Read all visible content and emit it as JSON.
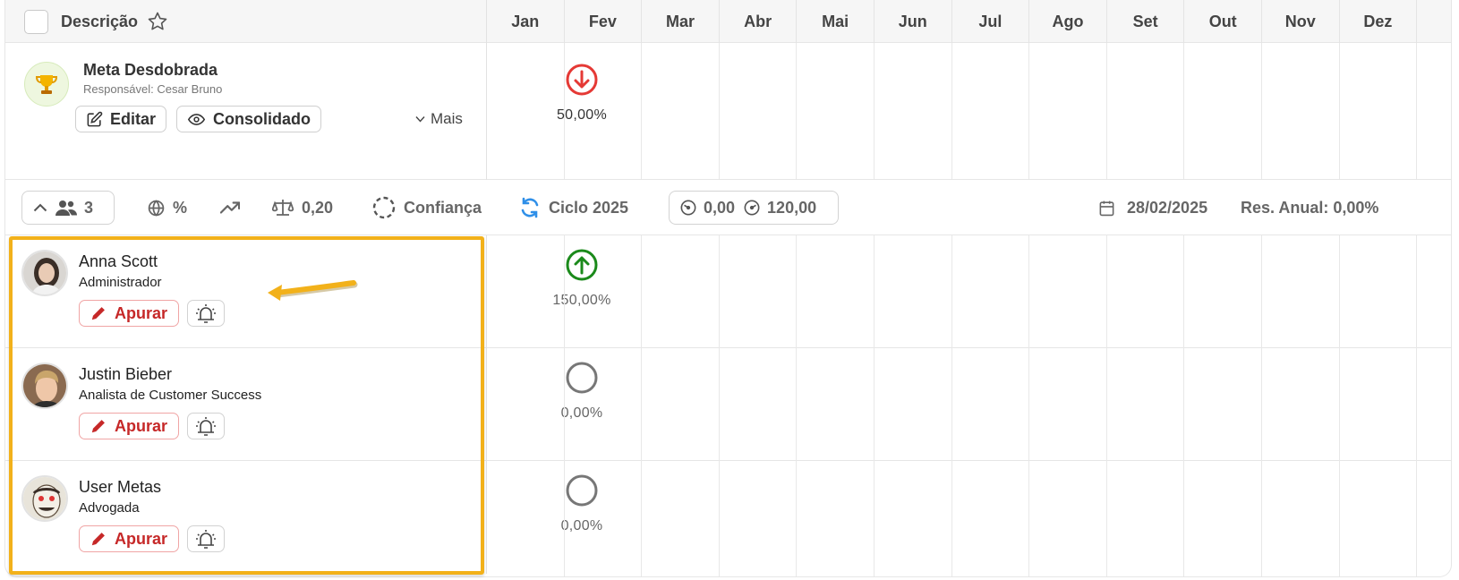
{
  "header": {
    "description_label": "Descrição",
    "months": [
      "Jan",
      "Fev",
      "Mar",
      "Abr",
      "Mai",
      "Jun",
      "Jul",
      "Ago",
      "Set",
      "Out",
      "Nov",
      "Dez"
    ]
  },
  "goal": {
    "title": "Meta Desdobrada",
    "responsible": "Responsável: Cesar Bruno",
    "edit_label": "Editar",
    "consolidated_label": "Consolidado",
    "more_label": "Mais",
    "feb_value": "50,00%",
    "feb_status": "down",
    "status_colors": {
      "down": "#e53935",
      "up": "#1b8a1b",
      "none": "#777777"
    }
  },
  "toolbar": {
    "participants_count": "3",
    "unit": "%",
    "weight": "0,20",
    "confidence_label": "Confiança",
    "cycle_label": "Ciclo 2025",
    "range_min": "0,00",
    "range_max": "120,00",
    "date": "28/02/2025",
    "annual_result": "Res. Anual: 0,00%"
  },
  "users": [
    {
      "name": "Anna Scott",
      "role": "Administrador",
      "apurar_label": "Apurar",
      "feb_value": "150,00%",
      "feb_status": "up"
    },
    {
      "name": "Justin Bieber",
      "role": "Analista de Customer Success",
      "apurar_label": "Apurar",
      "feb_value": "0,00%",
      "feb_status": "none"
    },
    {
      "name": "User Metas",
      "role": "Advogada",
      "apurar_label": "Apurar",
      "feb_value": "0,00%",
      "feb_status": "none"
    }
  ],
  "accent_colors": {
    "highlight": "#f2b11a",
    "apurar": "#c62828",
    "cycle_icon": "#2f8fe8"
  }
}
